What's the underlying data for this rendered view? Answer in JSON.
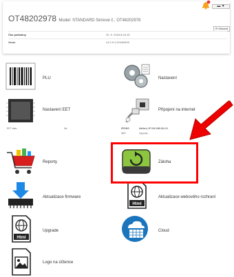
{
  "header": {
    "device_id": "OT48202978",
    "model_line": "Model: STANDARD Sériové č.: OT48202978",
    "refresh_label": "⟳ Obnovit",
    "lang_label": "▬ ▼",
    "rows": [
      {
        "key": "Čas pokladny",
        "value": "20. 9. 2018 8:34:15"
      },
      {
        "key": "Verze",
        "value": "v3.2.H.4.20180909"
      }
    ]
  },
  "tiles": {
    "plu": "PLU",
    "nastaveni": "Nastavení",
    "nastaveni_eet": "Nastavení EET",
    "pripojeni": "Připojení na internet",
    "reporty": "Reporty",
    "zaloha": "Záloha",
    "aktualizace_firmware": "Aktualizace firmware",
    "aktualizace_web": "Aktualizace webového rozhraní",
    "upgrade": "Upgrade",
    "cloud": "Cloud",
    "logo": "Logo na účtence"
  },
  "eet_strip": {
    "label": "EET stav:",
    "value": "Ne"
  },
  "net_strip": {
    "label": "IP/DNS",
    "status": "Aktivní, IP 192.168.241.21",
    "sub_label": "WiFi",
    "sub_value": "Vypnuto"
  },
  "colors": {
    "highlight": "#ff0000",
    "arrow": "#ee0000",
    "zaloha_green": "#8cc63f",
    "cloud_blue": "#1b75bc"
  }
}
